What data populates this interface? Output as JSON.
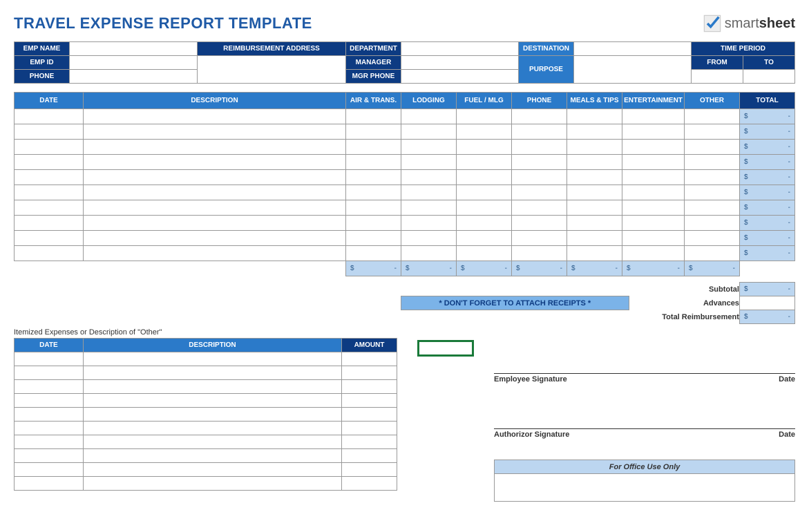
{
  "title": "TRAVEL EXPENSE REPORT TEMPLATE",
  "logo": {
    "brand_light": "smart",
    "brand_bold": "sheet"
  },
  "info": {
    "emp_name_label": "EMP NAME",
    "emp_id_label": "EMP ID",
    "phone_label": "PHONE",
    "reimb_addr_label": "REIMBURSEMENT ADDRESS",
    "department_label": "DEPARTMENT",
    "manager_label": "MANAGER",
    "mgr_phone_label": "MGR PHONE",
    "destination_label": "DESTINATION",
    "purpose_label": "PURPOSE",
    "time_period_label": "TIME PERIOD",
    "from_label": "FROM",
    "to_label": "TO"
  },
  "main": {
    "headers": {
      "date": "DATE",
      "description": "DESCRIPTION",
      "air": "AIR & TRANS.",
      "lodging": "LODGING",
      "fuel": "FUEL / MLG",
      "phone": "PHONE",
      "meals": "MEALS & TIPS",
      "ent": "ENTERTAINMENT",
      "other": "OTHER",
      "total": "TOTAL"
    },
    "currency": "$",
    "dash": "-",
    "row_count": 10
  },
  "receipts_note": "* DON'T FORGET TO ATTACH RECEIPTS *",
  "summary": {
    "subtotal_label": "Subtotal",
    "advances_label": "Advances",
    "total_reimb_label": "Total Reimbursement"
  },
  "itemized": {
    "caption": "Itemized Expenses or Description of \"Other\"",
    "headers": {
      "date": "DATE",
      "description": "DESCRIPTION",
      "amount": "AMOUNT"
    },
    "row_count": 10
  },
  "signatures": {
    "employee": "Employee Signature",
    "authorizor": "Authorizor Signature",
    "date": "Date"
  },
  "office": {
    "heading": "For Office Use Only"
  }
}
